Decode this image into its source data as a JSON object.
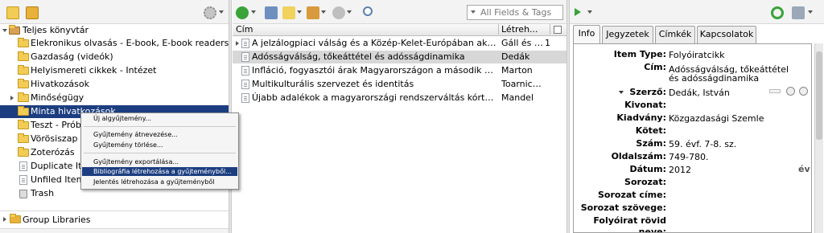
{
  "left_pane": {
    "collections": [
      {
        "label": "Teljes könyvtár"
      },
      {
        "label": "Elekronikus olvasás - E-book, E-book readers"
      },
      {
        "label": "Gazdaság (videók)"
      },
      {
        "label": "Helyismereti cikkek - Intézet"
      },
      {
        "label": "Hivatkozások"
      },
      {
        "label": "Minőségügy"
      },
      {
        "label": "Minta hivatkozások"
      },
      {
        "label": "Teszt - Próba"
      },
      {
        "label": "Vörösiszap és"
      },
      {
        "label": "Zoterózás"
      },
      {
        "label": "Duplicate Iter"
      },
      {
        "label": "Unfiled Items"
      },
      {
        "label": "Trash"
      }
    ],
    "group_libraries": "Group Libraries"
  },
  "context_menu": {
    "items": [
      "Új algyűjtemény...",
      "Gyűjtemény átnevezése...",
      "Gyűjtemény törlése...",
      "Gyűjtemény exportálása...",
      "Bibliográfia létrehozása a gyűjteményből...",
      "Jelentés létrehozása a gyűjteményből"
    ]
  },
  "middle_pane": {
    "search_placeholder": "All Fields & Tags",
    "columns": {
      "title": "Cím",
      "creator": "Létreh..."
    },
    "items": [
      {
        "title": "A jelzálogpiaci válság és a Közép-Kelet-Európában aktív nagyba...",
        "creator": "Gáll és L...",
        "count": "1"
      },
      {
        "title": "Adósságválság, tőkeáttétel és adósságdinamika",
        "creator": "Dedák",
        "count": ""
      },
      {
        "title": "Infláció, fogyasztói árak Magyarországon a második világhábor...",
        "creator": "Marton",
        "count": ""
      },
      {
        "title": "Multikulturális szervezet és identitás",
        "creator": "Toarnicz...",
        "count": ""
      },
      {
        "title": "Újabb adalékok a magyarországi rendszerváltás kórtörténetéhez",
        "creator": "Mandel",
        "count": ""
      }
    ]
  },
  "right_pane": {
    "tabs": [
      "Info",
      "Jegyzetek",
      "Címkék",
      "Kapcsolatok"
    ],
    "fields": [
      {
        "label": "Item Type:",
        "value": "Folyóiratcikk"
      },
      {
        "label": "Cím:",
        "value": "Adósságválság, tőkeáttétel és adósságdinamika"
      },
      {
        "label": "Szerző:",
        "value": "Dedák, István"
      },
      {
        "label": "Kivonat:",
        "value": ""
      },
      {
        "label": "Kiadvány:",
        "value": "Közgazdasági Szemle"
      },
      {
        "label": "Kötet:",
        "value": ""
      },
      {
        "label": "Szám:",
        "value": "59. évf. 7-8. sz."
      },
      {
        "label": "Oldalszám:",
        "value": "749-780."
      },
      {
        "label": "Dátum:",
        "value": "2012"
      },
      {
        "label": "Sorozat:",
        "value": ""
      },
      {
        "label": "Sorozat címe:",
        "value": ""
      },
      {
        "label": "Sorozat szövege:",
        "value": ""
      },
      {
        "label": "Folyóirat rövid neve:",
        "value": ""
      }
    ],
    "date_suffix": "év"
  },
  "colors": {
    "selection": "#1c3e80",
    "folder": "#f2cc55",
    "add_icon": "#3aa33a",
    "sync_icon": "#3aa33a"
  }
}
